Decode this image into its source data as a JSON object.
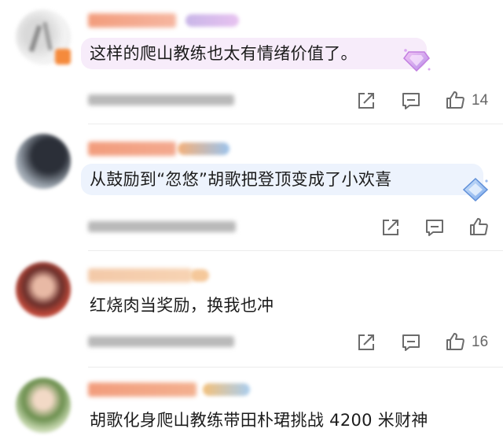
{
  "comments": [
    {
      "text": "这样的爬山教练也太有情绪价值了。",
      "likes": "14",
      "has_badge": true
    },
    {
      "text": "从鼓励到“忽悠”胡歌把登顶变成了小欢喜",
      "likes": "",
      "has_badge": true
    },
    {
      "text": "红烧肉当奖励，换我也冲",
      "likes": "16",
      "has_badge": false
    },
    {
      "text": "胡歌化身爬山教练带田朴珺挑战 4200 米财神",
      "likes": "",
      "has_badge": false
    }
  ],
  "icons": {
    "share": "share-icon",
    "reply": "comment-icon",
    "like": "thumbs-up-icon",
    "badge": "diamond-badge-icon"
  },
  "colors": {
    "bubble_pink": "#f7ecfa",
    "bubble_blue": "#edf3fd",
    "icon_gray": "#6b6b6b"
  }
}
